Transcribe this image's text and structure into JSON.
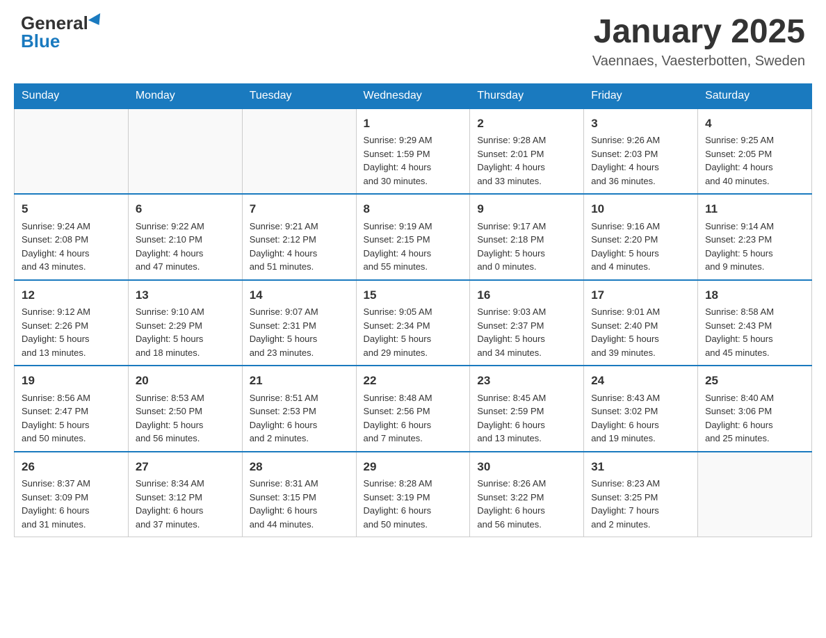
{
  "header": {
    "logo_general": "General",
    "logo_blue": "Blue",
    "month_title": "January 2025",
    "location": "Vaennaes, Vaesterbotten, Sweden"
  },
  "weekdays": [
    "Sunday",
    "Monday",
    "Tuesday",
    "Wednesday",
    "Thursday",
    "Friday",
    "Saturday"
  ],
  "weeks": [
    [
      {
        "day": "",
        "info": ""
      },
      {
        "day": "",
        "info": ""
      },
      {
        "day": "",
        "info": ""
      },
      {
        "day": "1",
        "info": "Sunrise: 9:29 AM\nSunset: 1:59 PM\nDaylight: 4 hours\nand 30 minutes."
      },
      {
        "day": "2",
        "info": "Sunrise: 9:28 AM\nSunset: 2:01 PM\nDaylight: 4 hours\nand 33 minutes."
      },
      {
        "day": "3",
        "info": "Sunrise: 9:26 AM\nSunset: 2:03 PM\nDaylight: 4 hours\nand 36 minutes."
      },
      {
        "day": "4",
        "info": "Sunrise: 9:25 AM\nSunset: 2:05 PM\nDaylight: 4 hours\nand 40 minutes."
      }
    ],
    [
      {
        "day": "5",
        "info": "Sunrise: 9:24 AM\nSunset: 2:08 PM\nDaylight: 4 hours\nand 43 minutes."
      },
      {
        "day": "6",
        "info": "Sunrise: 9:22 AM\nSunset: 2:10 PM\nDaylight: 4 hours\nand 47 minutes."
      },
      {
        "day": "7",
        "info": "Sunrise: 9:21 AM\nSunset: 2:12 PM\nDaylight: 4 hours\nand 51 minutes."
      },
      {
        "day": "8",
        "info": "Sunrise: 9:19 AM\nSunset: 2:15 PM\nDaylight: 4 hours\nand 55 minutes."
      },
      {
        "day": "9",
        "info": "Sunrise: 9:17 AM\nSunset: 2:18 PM\nDaylight: 5 hours\nand 0 minutes."
      },
      {
        "day": "10",
        "info": "Sunrise: 9:16 AM\nSunset: 2:20 PM\nDaylight: 5 hours\nand 4 minutes."
      },
      {
        "day": "11",
        "info": "Sunrise: 9:14 AM\nSunset: 2:23 PM\nDaylight: 5 hours\nand 9 minutes."
      }
    ],
    [
      {
        "day": "12",
        "info": "Sunrise: 9:12 AM\nSunset: 2:26 PM\nDaylight: 5 hours\nand 13 minutes."
      },
      {
        "day": "13",
        "info": "Sunrise: 9:10 AM\nSunset: 2:29 PM\nDaylight: 5 hours\nand 18 minutes."
      },
      {
        "day": "14",
        "info": "Sunrise: 9:07 AM\nSunset: 2:31 PM\nDaylight: 5 hours\nand 23 minutes."
      },
      {
        "day": "15",
        "info": "Sunrise: 9:05 AM\nSunset: 2:34 PM\nDaylight: 5 hours\nand 29 minutes."
      },
      {
        "day": "16",
        "info": "Sunrise: 9:03 AM\nSunset: 2:37 PM\nDaylight: 5 hours\nand 34 minutes."
      },
      {
        "day": "17",
        "info": "Sunrise: 9:01 AM\nSunset: 2:40 PM\nDaylight: 5 hours\nand 39 minutes."
      },
      {
        "day": "18",
        "info": "Sunrise: 8:58 AM\nSunset: 2:43 PM\nDaylight: 5 hours\nand 45 minutes."
      }
    ],
    [
      {
        "day": "19",
        "info": "Sunrise: 8:56 AM\nSunset: 2:47 PM\nDaylight: 5 hours\nand 50 minutes."
      },
      {
        "day": "20",
        "info": "Sunrise: 8:53 AM\nSunset: 2:50 PM\nDaylight: 5 hours\nand 56 minutes."
      },
      {
        "day": "21",
        "info": "Sunrise: 8:51 AM\nSunset: 2:53 PM\nDaylight: 6 hours\nand 2 minutes."
      },
      {
        "day": "22",
        "info": "Sunrise: 8:48 AM\nSunset: 2:56 PM\nDaylight: 6 hours\nand 7 minutes."
      },
      {
        "day": "23",
        "info": "Sunrise: 8:45 AM\nSunset: 2:59 PM\nDaylight: 6 hours\nand 13 minutes."
      },
      {
        "day": "24",
        "info": "Sunrise: 8:43 AM\nSunset: 3:02 PM\nDaylight: 6 hours\nand 19 minutes."
      },
      {
        "day": "25",
        "info": "Sunrise: 8:40 AM\nSunset: 3:06 PM\nDaylight: 6 hours\nand 25 minutes."
      }
    ],
    [
      {
        "day": "26",
        "info": "Sunrise: 8:37 AM\nSunset: 3:09 PM\nDaylight: 6 hours\nand 31 minutes."
      },
      {
        "day": "27",
        "info": "Sunrise: 8:34 AM\nSunset: 3:12 PM\nDaylight: 6 hours\nand 37 minutes."
      },
      {
        "day": "28",
        "info": "Sunrise: 8:31 AM\nSunset: 3:15 PM\nDaylight: 6 hours\nand 44 minutes."
      },
      {
        "day": "29",
        "info": "Sunrise: 8:28 AM\nSunset: 3:19 PM\nDaylight: 6 hours\nand 50 minutes."
      },
      {
        "day": "30",
        "info": "Sunrise: 8:26 AM\nSunset: 3:22 PM\nDaylight: 6 hours\nand 56 minutes."
      },
      {
        "day": "31",
        "info": "Sunrise: 8:23 AM\nSunset: 3:25 PM\nDaylight: 7 hours\nand 2 minutes."
      },
      {
        "day": "",
        "info": ""
      }
    ]
  ]
}
